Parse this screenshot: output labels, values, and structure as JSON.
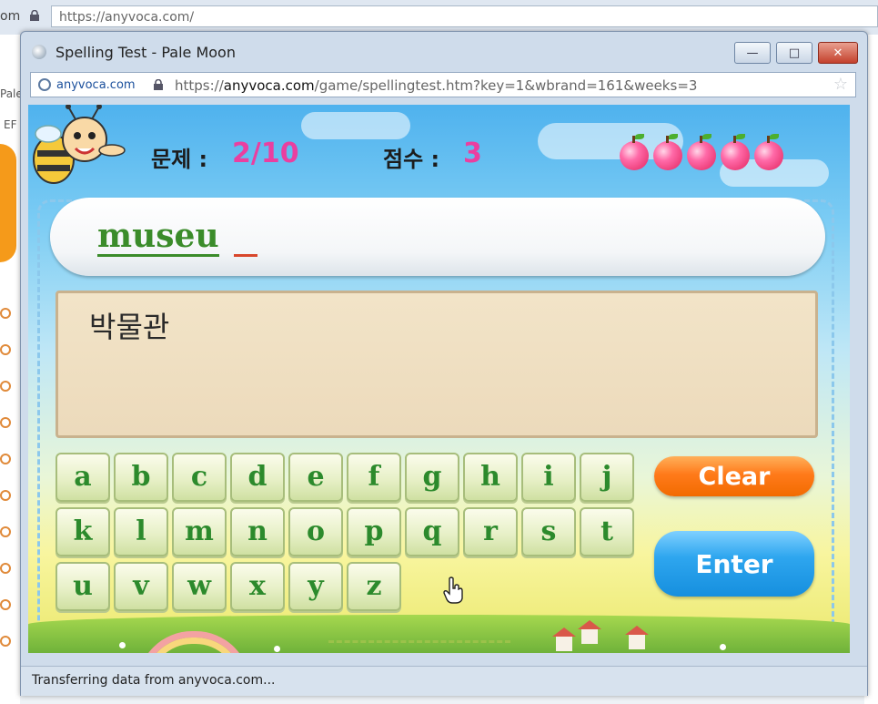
{
  "background_browser": {
    "left_partial_text": "om",
    "url": "https://anyvoca.com/",
    "left_tab_fragment_1": "Pale",
    "left_tab_fragment_2": "EF"
  },
  "window": {
    "title": "Spelling Test - Pale Moon",
    "site_identity": "anyvoca.com",
    "url_prefix": "https://",
    "url_domain": "anyvoca.com",
    "url_path": "/game/spellingtest.htm?key=1&wbrand=161&weeks=3",
    "status_text": "Transferring data from anyvoca.com..."
  },
  "game": {
    "question_label": "문제 :",
    "question_value": "2/10",
    "score_label": "점수 :",
    "score_value": "3",
    "lives_remaining": 5,
    "typed_text": "museu",
    "meaning": "박물관",
    "keys_row1": [
      "a",
      "b",
      "c",
      "d",
      "e",
      "f",
      "g",
      "h",
      "i",
      "j"
    ],
    "keys_row2": [
      "k",
      "l",
      "m",
      "n",
      "o",
      "p",
      "q",
      "r",
      "s",
      "t"
    ],
    "keys_row3": [
      "u",
      "v",
      "w",
      "x",
      "y",
      "z"
    ],
    "clear_label": "Clear",
    "enter_label": "Enter"
  },
  "colors": {
    "score_accent": "#ea3fa0",
    "typed_text": "#3b8c2a",
    "key_text": "#2c8a2c",
    "clear_button": "#ff7a1a",
    "enter_button": "#1b9be6"
  }
}
